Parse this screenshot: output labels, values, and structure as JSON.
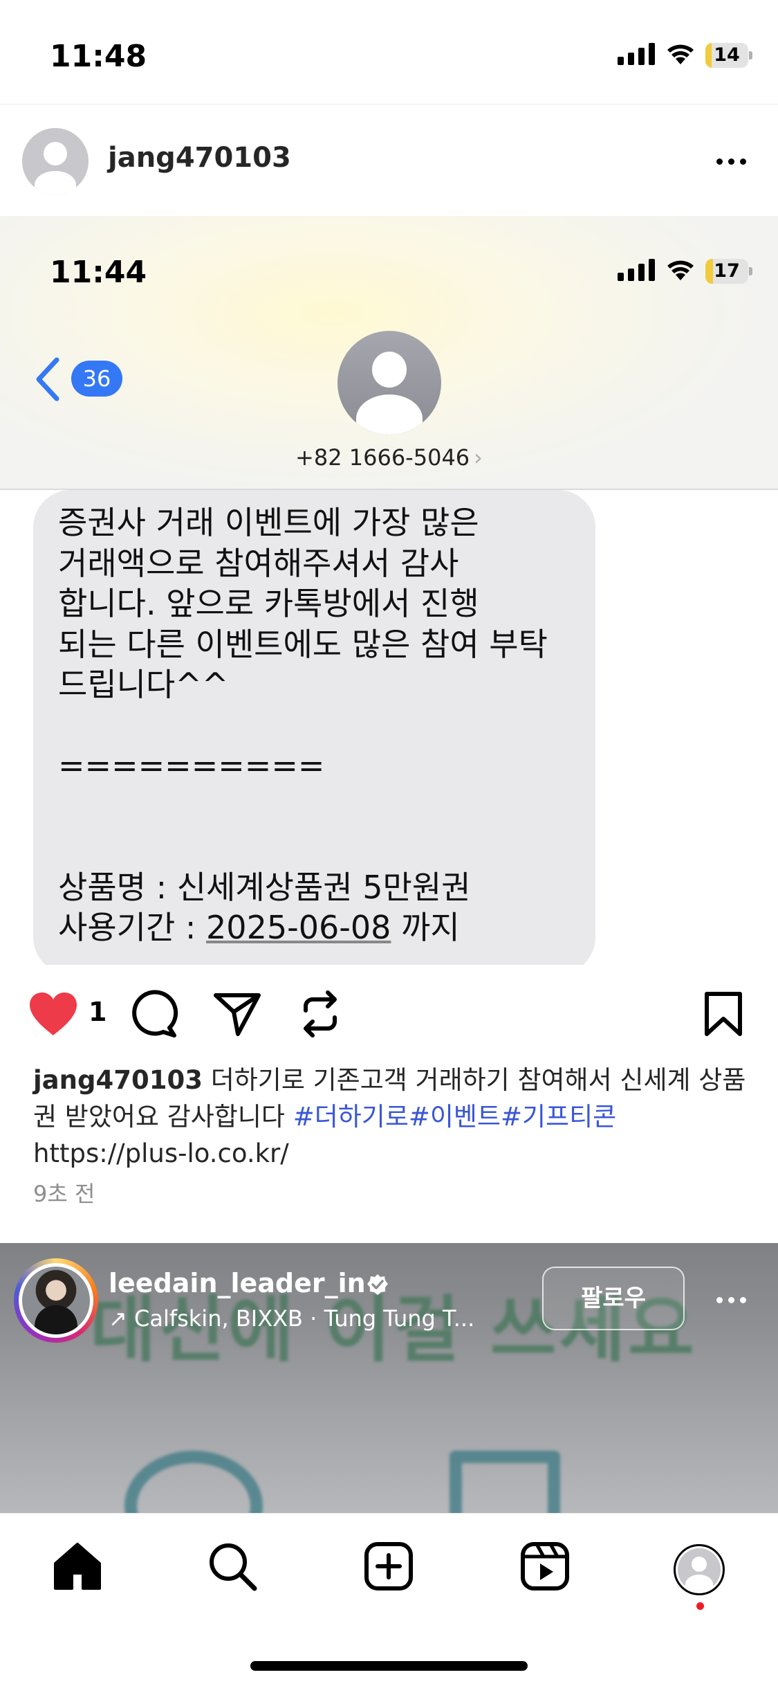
{
  "status_bar": {
    "time": "11:48",
    "battery": "14",
    "battery_level": 0.14
  },
  "post": {
    "username": "jang470103",
    "screenshot": {
      "time": "11:44",
      "battery": "17",
      "battery_level": 0.17,
      "unread_count": "36",
      "sender_number": "+82 1666-5046",
      "message_lines": [
        "증권사 거래 이벤트에 가장 많은",
        "거래액으로 참여해주셔서 감사",
        "합니다. 앞으로 카톡방에서 진행",
        "되는 다른 이벤트에도 많은 참여 부탁",
        "드립니다^^",
        "",
        "==========",
        "",
        "",
        "상품명 : 신세계상품권 5만원권"
      ],
      "period_label": "사용기간 : ",
      "period_date": "2025-06-08",
      "period_suffix": " 까지"
    },
    "like_count": "1",
    "caption": {
      "username": "jang470103",
      "text": "더하기로 기존고객 거래하기 참여해서 신세계 상품권 받았어요 감사합니다",
      "hashtags": "#더하기로#이벤트#기프티콘",
      "link": "https://plus-lo.co.kr/"
    },
    "time_ago": "9초 전"
  },
  "next_post": {
    "username": "leedain_leader_in",
    "subtitle": "Calfskin, BIXXB · Tung Tung T...",
    "follow_label": "팔로우",
    "background_text": "대신에 이걸 쓰세요"
  },
  "tabbar": {
    "items": [
      "home-icon",
      "search-icon",
      "create-icon",
      "reels-icon",
      "profile-avatar"
    ]
  },
  "colors": {
    "like": "#ed3b4a",
    "hashtag": "#3956d4",
    "badge": "#3478f6",
    "battery_fill": "#f2cb3c"
  }
}
